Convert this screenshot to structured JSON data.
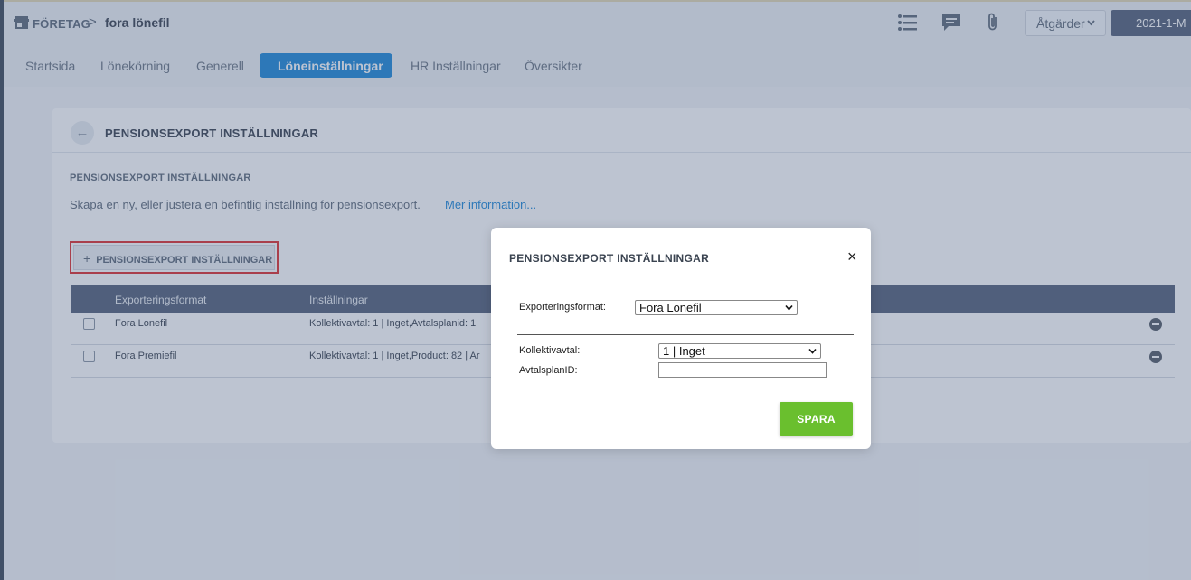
{
  "header": {
    "company_label": "FÖRETAG",
    "separator": ">",
    "file_name": "fora lönefil",
    "actions_label": "Åtgärder",
    "period_label": "2021-1-M"
  },
  "nav": {
    "tabs": [
      {
        "label": "Startsida"
      },
      {
        "label": "Lönekörning"
      },
      {
        "label": "Generell"
      },
      {
        "label": "Löneinställningar"
      },
      {
        "label": "HR Inställningar"
      },
      {
        "label": "Översikter"
      }
    ],
    "active_tab": "Löneinställningar"
  },
  "card": {
    "title": "PENSIONSEXPORT INSTÄLLNINGAR",
    "section_title": "PENSIONSEXPORT INSTÄLLNINGAR",
    "description": "Skapa en ny, eller justera en befintlig inställning för pensionsexport.",
    "more_link": "Mer information...",
    "add_button_icon": "+",
    "add_button_label": "PENSIONSEXPORT INSTÄLLNINGAR"
  },
  "table": {
    "columns": [
      "Exporteringsformat",
      "Inställningar"
    ],
    "rows": [
      {
        "format": "Fora Lonefil",
        "settings": "Kollektivavtal: 1 | Inget,Avtalsplanid: 1"
      },
      {
        "format": "Fora Premiefil",
        "settings": "Kollektivavtal: 1 | Inget,Product: 82 | Ar"
      }
    ]
  },
  "modal": {
    "title": "PENSIONSEXPORT INSTÄLLNINGAR",
    "close_glyph": "×",
    "format_label": "Exporteringsformat:",
    "format_value": "Fora Lonefil",
    "agreement_label": "Kollektivavtal:",
    "agreement_value": "1 | Inget",
    "plan_id_label": "AvtalsplanID:",
    "plan_id_value": "",
    "save_label": "SPARA"
  },
  "colors": {
    "accent": "#1e88d8",
    "save": "#6abf2e",
    "table_header": "#55627a",
    "highlight_border": "#e03030"
  },
  "icons": [
    "store-icon",
    "list-icon",
    "comment-icon",
    "paperclip-icon",
    "chevron-down-icon",
    "back-arrow-icon",
    "close-icon",
    "remove-icon"
  ]
}
